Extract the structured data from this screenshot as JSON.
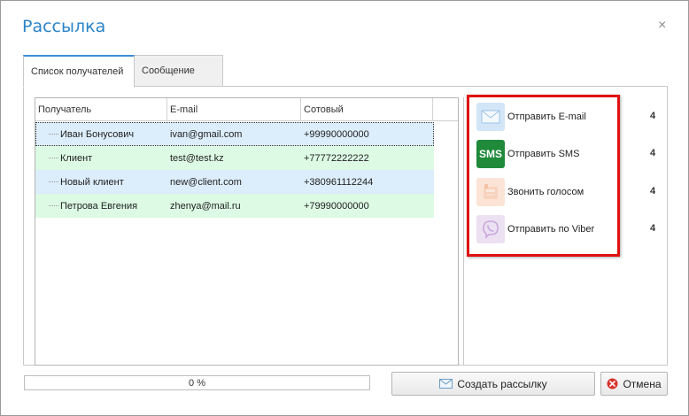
{
  "window": {
    "title": "Рассылка",
    "close_glyph": "×"
  },
  "tabs": [
    {
      "label": "Список получателей",
      "active": true
    },
    {
      "label": "Сообщение",
      "active": false
    }
  ],
  "grid": {
    "columns": [
      "Получатель",
      "E-mail",
      "Сотовый"
    ],
    "rows": [
      {
        "name": "Иван Бонусович",
        "email": "ivan@gmail.com",
        "phone": "+99990000000",
        "color": "#dcedfb"
      },
      {
        "name": "Клиент",
        "email": "test@test.kz",
        "phone": "+77772222222",
        "color": "#dcfae4"
      },
      {
        "name": "Новый клиент",
        "email": "new@client.com",
        "phone": "+380961112244",
        "color": "#dcedfb"
      },
      {
        "name": "Петрова Евгения",
        "email": "zhenya@mail.ru",
        "phone": "+79990000000",
        "color": "#dcfae4"
      }
    ]
  },
  "actions": [
    {
      "label": "Отправить E-mail",
      "count": "4",
      "icon": "envelope-icon"
    },
    {
      "label": "Отправить SMS",
      "count": "4",
      "icon": "sms-icon",
      "icon_text": "SMS"
    },
    {
      "label": "Звонить голосом",
      "count": "4",
      "icon": "phone-icon"
    },
    {
      "label": "Отправить по Viber",
      "count": "4",
      "icon": "viber-icon"
    }
  ],
  "progress": {
    "text": "0 %",
    "value": 0
  },
  "buttons": {
    "create_label": "Создать рассылку",
    "cancel_label": "Отмена"
  },
  "colors": {
    "accent": "#2a84c8",
    "highlight": "#e01111",
    "row_blue": "#dcedfb",
    "row_green": "#dcfae4",
    "sms_green": "#1e8a3a"
  }
}
